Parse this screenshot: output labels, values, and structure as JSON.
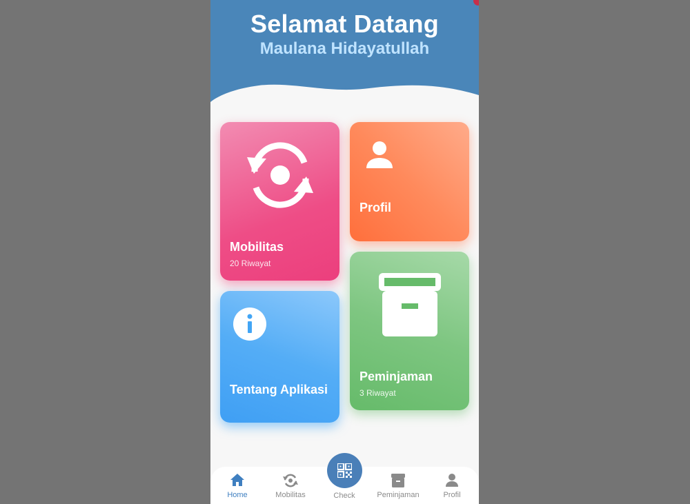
{
  "header": {
    "title": "Selamat Datang",
    "user_name": "Maulana Hidayatullah"
  },
  "cards": {
    "mobilitas": {
      "title": "Mobilitas",
      "subtitle": "20 Riwayat",
      "icon": "sync-person-icon"
    },
    "profil": {
      "title": "Profil",
      "icon": "person-icon"
    },
    "tentang": {
      "title": "Tentang Aplikasi",
      "icon": "info-icon"
    },
    "peminjaman": {
      "title": "Peminjaman",
      "subtitle": "3 Riwayat",
      "icon": "archive-box-icon"
    }
  },
  "nav": {
    "home": "Home",
    "mobilitas": "Mobilitas",
    "check": "Check",
    "peminjaman": "Peminjaman",
    "profil": "Profil"
  },
  "colors": {
    "header": "#4a86b9",
    "mobilitas": "#ec407a",
    "profil": "#ff7043",
    "tentang": "#42a5f5",
    "peminjaman": "#66bb6a",
    "nav_active": "#3f7fc0"
  }
}
